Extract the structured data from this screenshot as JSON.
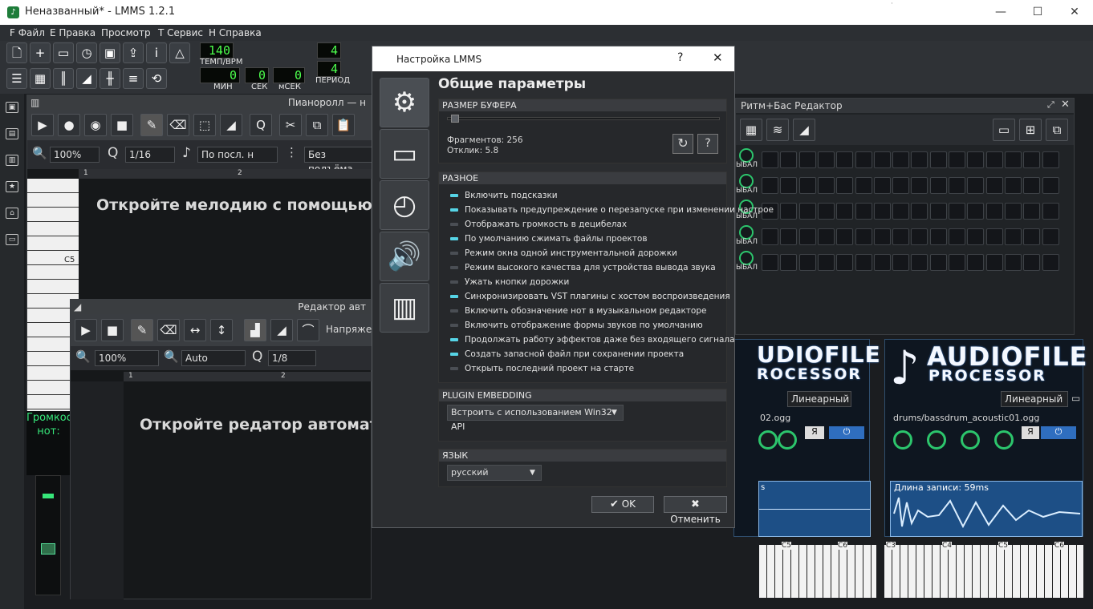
{
  "window": {
    "title": "Неназванный* - LMMS 1.2.1",
    "minimize": "—",
    "maximize": "☐",
    "close": "✕"
  },
  "menu": [
    {
      "label": "F Файл"
    },
    {
      "label": "E Правка"
    },
    {
      "label": "Просмотр"
    },
    {
      "label": "T Сервис"
    },
    {
      "label": "H Справка"
    }
  ],
  "transport": {
    "tempo": "140",
    "tempo_label": "ТЕМП/BPM",
    "min": "0",
    "min_label": "МИН",
    "sec": "0",
    "sec_label": "СЕК",
    "msec": "0",
    "msec_label": "мСЕК",
    "sig_top": "4",
    "sig_bottom": "4",
    "period_label": "ПЕРИОД"
  },
  "piano_roll": {
    "title": "Пианоролл — н",
    "zoom": "100%",
    "quant": "1/16",
    "note_len": "По посл. н",
    "scale": "Без подъёма",
    "bar_1": "1",
    "bar_2": "2",
    "key_label": "C5",
    "message": "Откройте мелодию с помощью дво"
  },
  "automation_editor": {
    "title": "Редактор авт",
    "mode_label": "Напряжени",
    "zoom_x": "100%",
    "zoom_y": "Auto",
    "quant": "1/8",
    "bar_1": "1",
    "bar_2": "2",
    "message": "Откройте редатор автоматиза"
  },
  "mixer_partial": {
    "line1": "Громкос",
    "line2": "нот:"
  },
  "dialog": {
    "title": "Настройка LMMS",
    "help": "?",
    "close": "✕",
    "heading": "Общие параметры",
    "buffer": {
      "header": "РАЗМЕР БУФЕРА",
      "fragments": "Фрагментов: 256",
      "latency": "Отклик: 5.8"
    },
    "misc": {
      "header": "РАЗНОЕ",
      "options": [
        {
          "label": "Включить подсказки",
          "on": true
        },
        {
          "label": "Показывать предупреждение о перезапуске при изменении настрое",
          "on": true
        },
        {
          "label": "Отображать громкость в децибелах",
          "on": false
        },
        {
          "label": "По умолчанию сжимать файлы проектов",
          "on": true
        },
        {
          "label": "Режим окна одной инструментальной дорожки",
          "on": false
        },
        {
          "label": "Режим высокого качества для устройства вывода звука",
          "on": false
        },
        {
          "label": "Ужать кнопки дорожки",
          "on": false
        },
        {
          "label": "Синхронизировать VST плагины с хостом воспроизведения",
          "on": true
        },
        {
          "label": "Включить обозначение нот в музыкальном редакторе",
          "on": false
        },
        {
          "label": "Включить отображение формы звуков по умолчанию",
          "on": false
        },
        {
          "label": "Продолжать работу эффектов даже без входящего сигнала",
          "on": true
        },
        {
          "label": "Создать запасной файл при сохранении проекта",
          "on": true
        },
        {
          "label": "Открыть последний проект на старте",
          "on": false
        }
      ]
    },
    "plugin": {
      "header": "PLUGIN EMBEDDING",
      "value": "Встроить с использованием Win32 API"
    },
    "lang": {
      "header": "ЯЗЫК",
      "value": "русский"
    },
    "ok": "OK",
    "cancel": "Отменить"
  },
  "beat_editor": {
    "title": "Ритм+Бас Редактор",
    "tracks": [
      {
        "label": "ЫБАЛ"
      },
      {
        "label": "ЫБАЛ"
      },
      {
        "label": "ЫБАЛ"
      },
      {
        "label": "ЫБАЛ"
      },
      {
        "label": "ЫБАЛ"
      }
    ],
    "steps": 16
  },
  "afp_left": {
    "logo1": "UDIOFILE",
    "logo2": "ROCESSOR",
    "interp": "Линеарный",
    "file": "02.ogg",
    "sample_label": "s",
    "note_c5": "C5",
    "note_c6": "C6"
  },
  "afp_right": {
    "logo1": "AUDIOFILE",
    "logo2": "PROCESSOR",
    "interp": "Линеарный",
    "file": "drums/bassdrum_acoustic01.ogg",
    "sample_len": "Длина записи: 59ms",
    "note_c3": "C3",
    "note_c4": "C4",
    "note_c5": "C5",
    "note_c6": "C6"
  },
  "colors": {
    "accent_led": "#56d4e6",
    "lcd_green": "#4dff4d",
    "knob_green": "#2cc56c"
  }
}
